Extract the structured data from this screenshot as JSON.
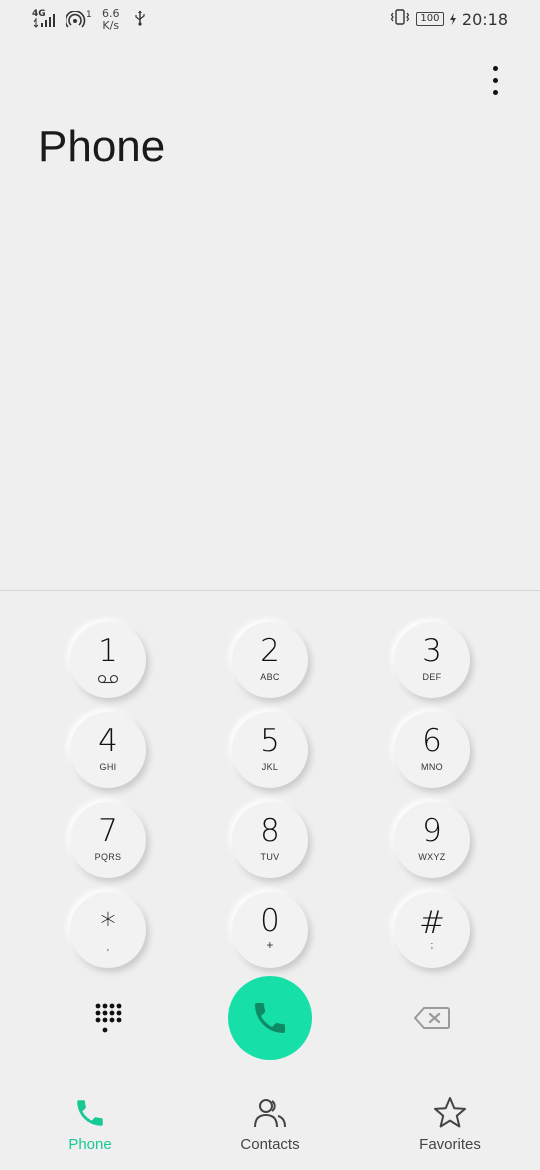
{
  "status_bar": {
    "network_type": "4G",
    "hotspot_count": "1",
    "speed_value": "6.6",
    "speed_unit": "K/s",
    "battery": "100",
    "time": "20:18"
  },
  "header": {
    "title": "Phone",
    "menu_icon": "more-vert-icon"
  },
  "dialpad": {
    "keys": [
      {
        "digit": "1",
        "sub": ""
      },
      {
        "digit": "2",
        "sub": "ABC"
      },
      {
        "digit": "3",
        "sub": "DEF"
      },
      {
        "digit": "4",
        "sub": "GHI"
      },
      {
        "digit": "5",
        "sub": "JKL"
      },
      {
        "digit": "6",
        "sub": "MNO"
      },
      {
        "digit": "7",
        "sub": "PQRS"
      },
      {
        "digit": "8",
        "sub": "TUV"
      },
      {
        "digit": "9",
        "sub": "WXYZ"
      },
      {
        "digit": "*",
        "sub": ","
      },
      {
        "digit": "0",
        "sub": "+"
      },
      {
        "digit": "#",
        "sub": ";"
      }
    ],
    "call_color": "#16e0a8"
  },
  "bottom_nav": {
    "items": [
      {
        "label": "Phone",
        "icon": "phone-icon",
        "active": true
      },
      {
        "label": "Contacts",
        "icon": "contacts-icon",
        "active": false
      },
      {
        "label": "Favorites",
        "icon": "star-icon",
        "active": false
      }
    ],
    "accent_color": "#18c996"
  }
}
